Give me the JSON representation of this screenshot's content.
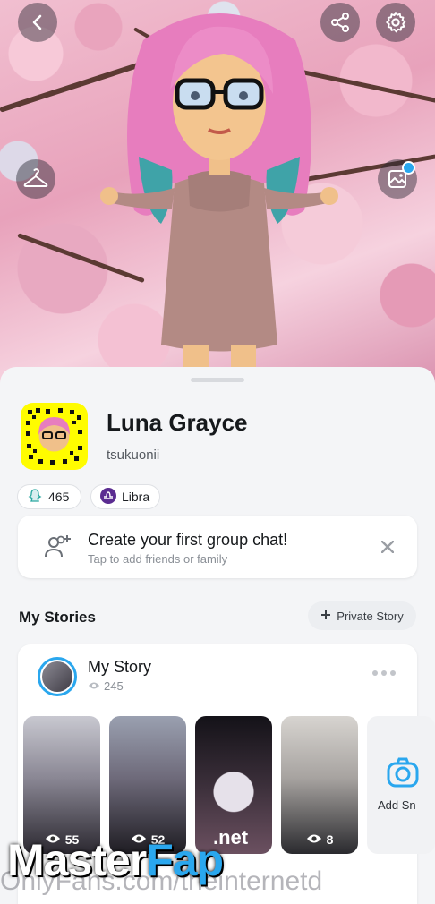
{
  "header": {
    "back_icon": "chevron-left-icon",
    "share_icon": "share-icon",
    "settings_icon": "gear-icon",
    "outfit_icon": "hanger-icon",
    "background_icon": "image-edit-icon"
  },
  "profile": {
    "display_name": "Luna Grayce",
    "username": "tsukuonii",
    "snapscore": "465",
    "zodiac": "Libra"
  },
  "group_chat_card": {
    "title": "Create your first group chat!",
    "subtitle": "Tap to add friends or family"
  },
  "stories": {
    "section_title": "My Stories",
    "private_story_label": "Private Story",
    "my_story_title": "My Story",
    "my_story_views": "245",
    "thumbnails": [
      {
        "views": "55"
      },
      {
        "views": "52"
      },
      {
        "views": ""
      },
      {
        "views": "8"
      }
    ],
    "add_snap_label": "Add Sn"
  },
  "watermark": {
    "brand_main": "Master",
    "brand_accent": "Fap",
    "brand_suffix": ".net",
    "subline": "OnlyFans.com/theinternetd"
  },
  "colors": {
    "accent_blue": "#2aa7ee",
    "snapcode_yellow": "#fffc00",
    "zodiac_purple": "#5b2c91"
  }
}
